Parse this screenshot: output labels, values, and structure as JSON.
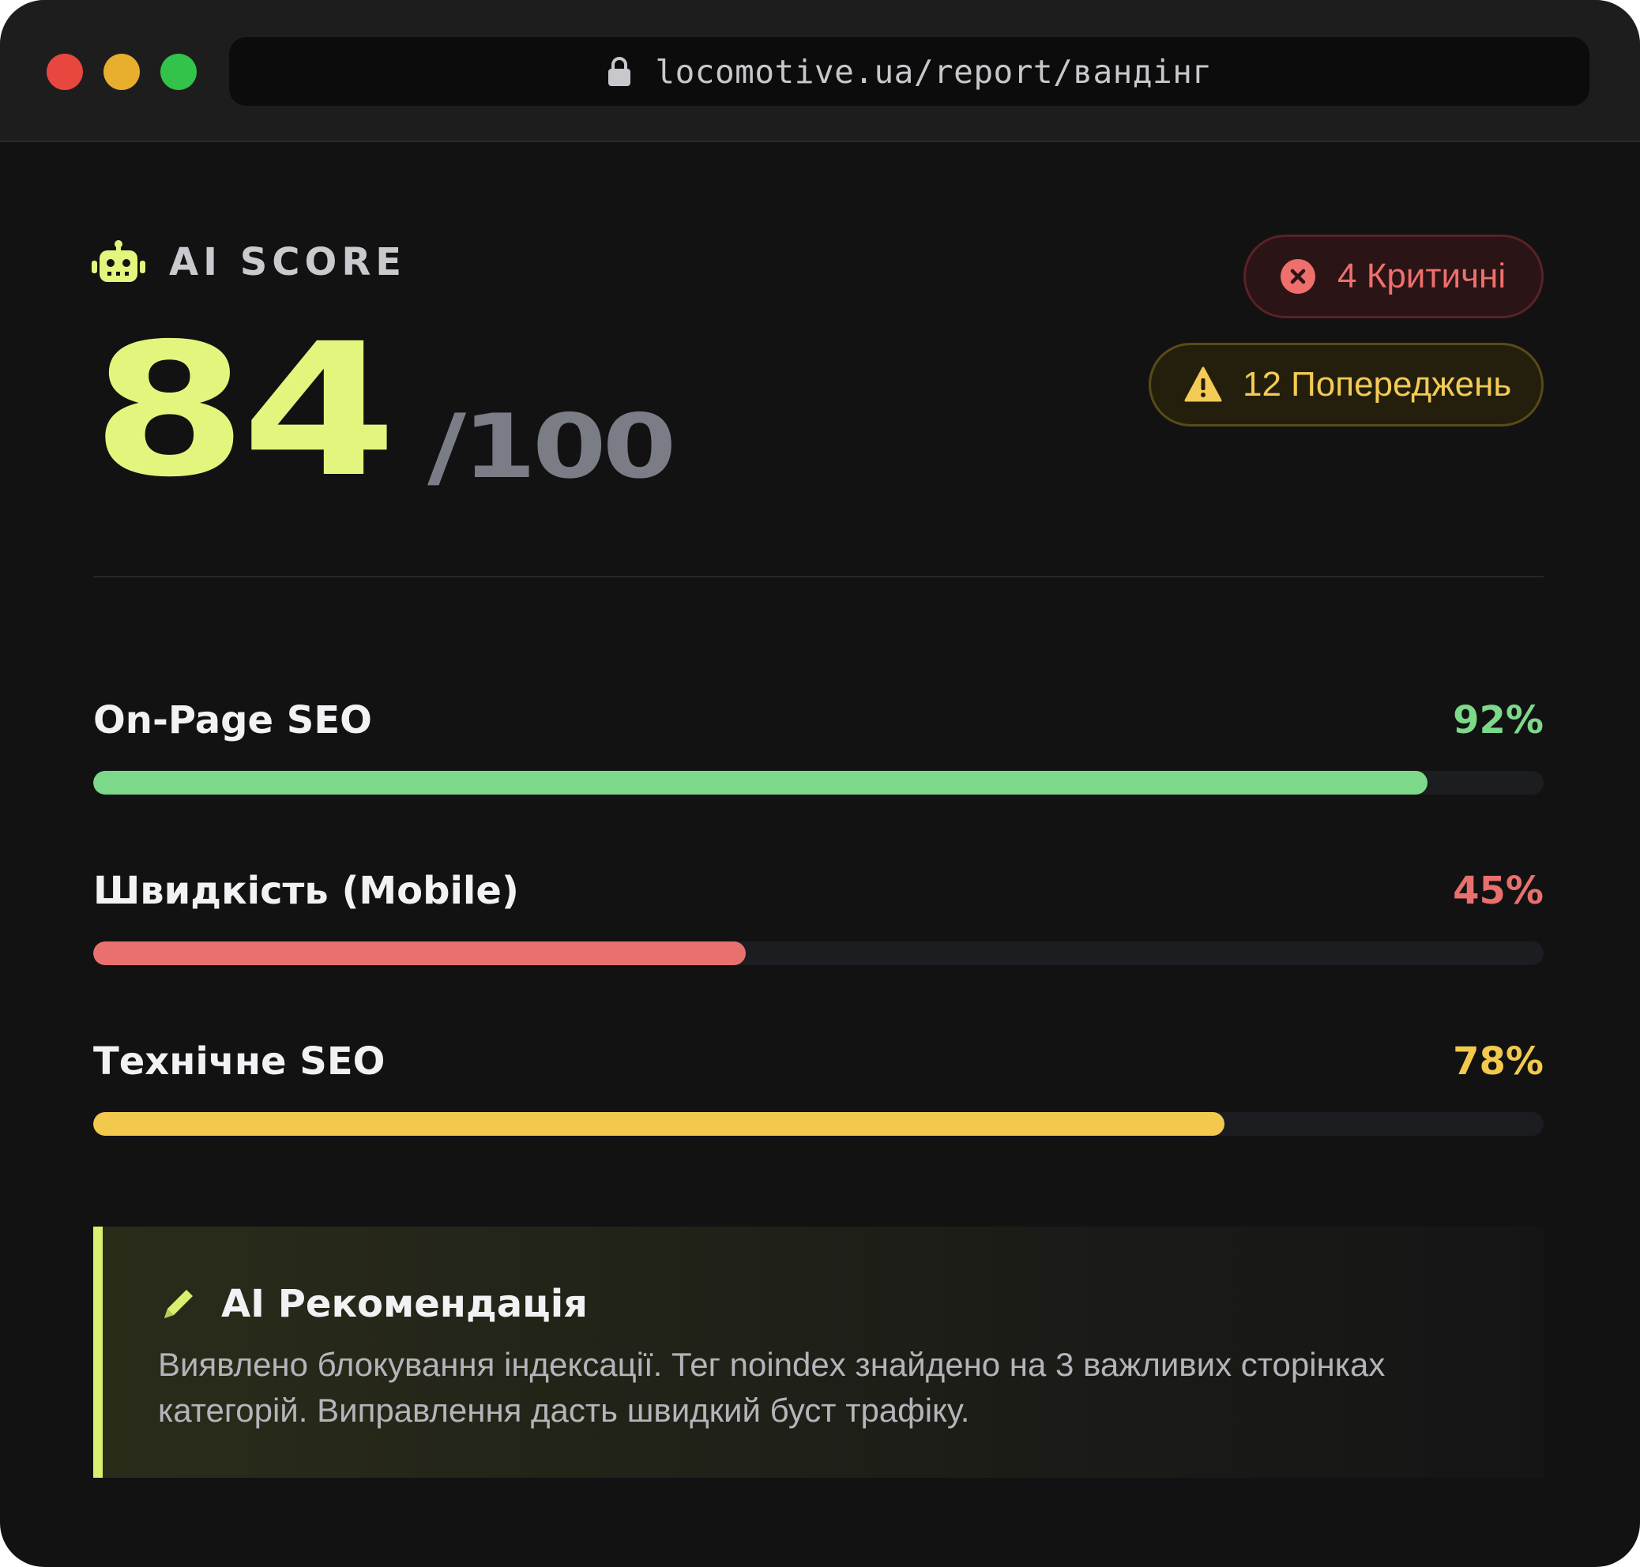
{
  "browser": {
    "url": "locomotive.ua/report/вандінг",
    "lock_icon": "lock-icon"
  },
  "score": {
    "label": "AI SCORE",
    "icon": "robot-icon",
    "value": "84",
    "max": "/100",
    "color": "#e3f57d"
  },
  "badges": {
    "critical": {
      "text": "4 Критичні",
      "icon": "x-circle-icon",
      "color": "#ef6f6c"
    },
    "warning": {
      "text": "12 Попереджень",
      "icon": "warning-triangle-icon",
      "color": "#f3cb55"
    }
  },
  "metrics": [
    {
      "label": "On-Page SEO",
      "value_text": "92%",
      "value": 92,
      "color": "#7cd98a"
    },
    {
      "label": "Швидкість (Mobile)",
      "value_text": "45%",
      "value": 45,
      "color": "#e8706e"
    },
    {
      "label": "Технічне SEO",
      "value_text": "78%",
      "value": 78,
      "color": "#f2c94c"
    }
  ],
  "recommendation": {
    "icon": "pencil-icon",
    "title": "AI Рекомендація",
    "body": "Виявлено блокування індексації. Тег noindex знайдено на 3 важливих сторінках категорій. Виправлення дасть швидкий буст трафіку.",
    "accent": "#d9ef6e"
  }
}
